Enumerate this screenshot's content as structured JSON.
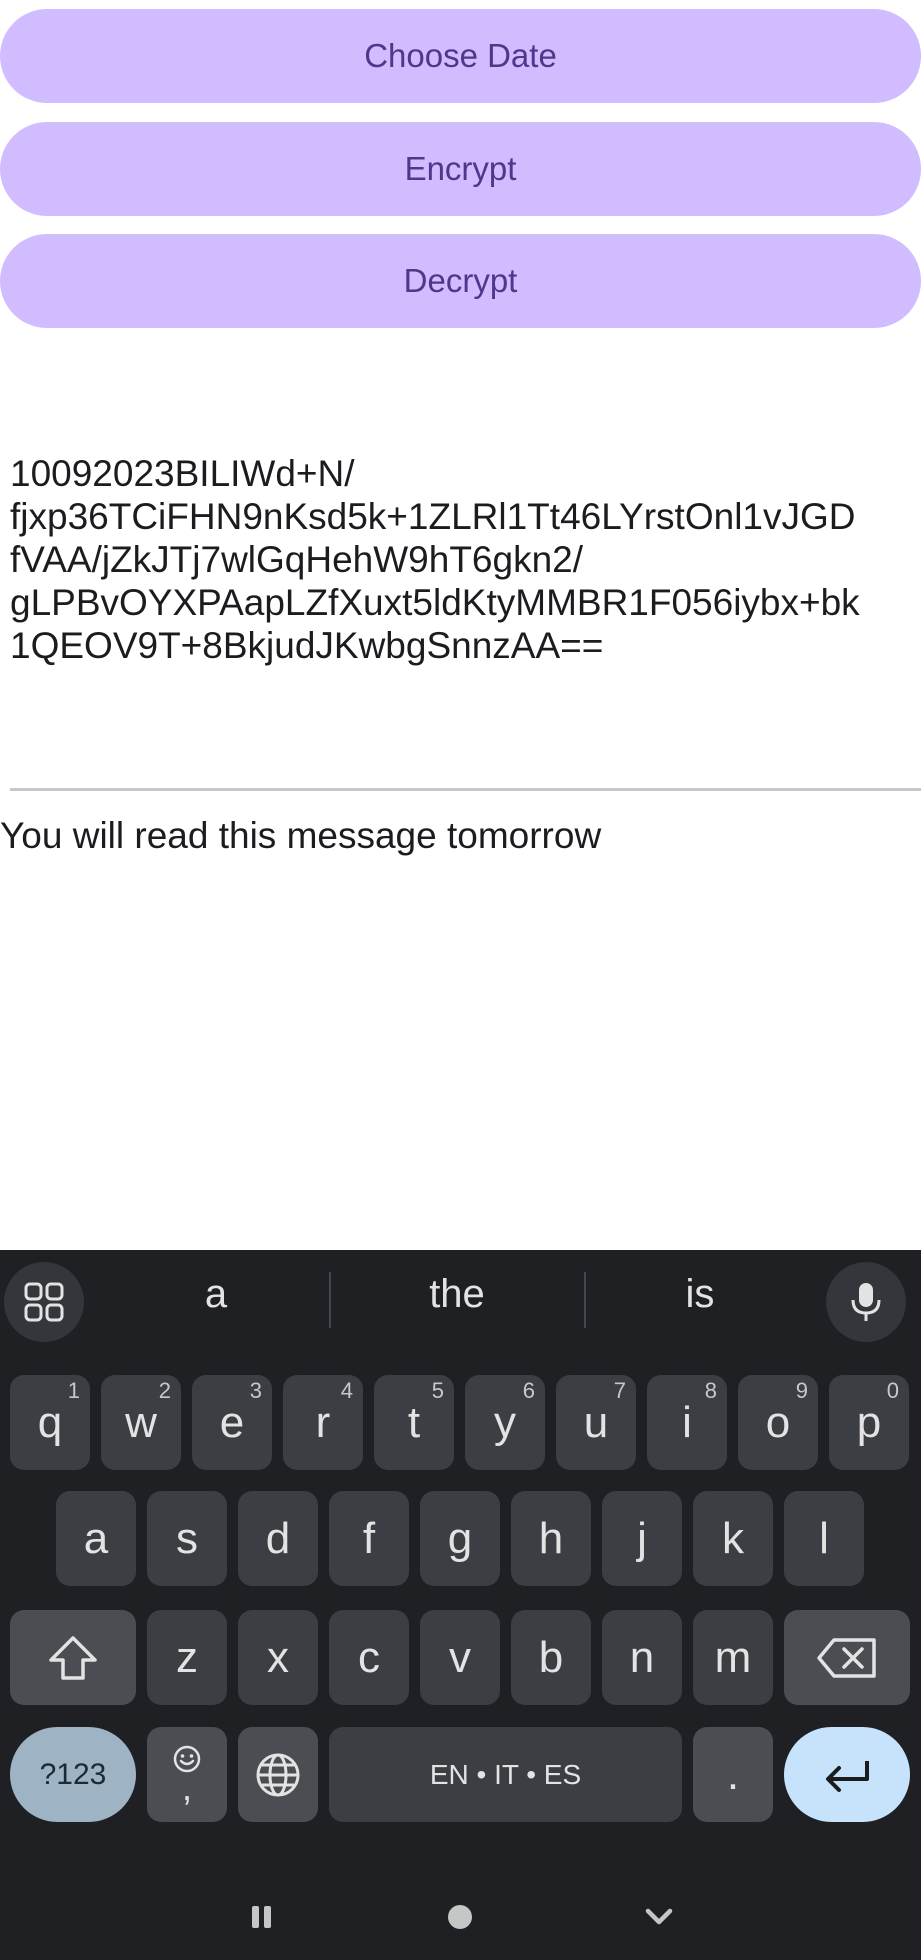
{
  "buttons": {
    "choose_date": "Choose Date",
    "encrypt": "Encrypt",
    "decrypt": "Decrypt"
  },
  "ciphertext_lines": [
    "10092023BILIWd+N/",
    "fjxp36TCiFHN9nKsd5k+1ZLRl1Tt46LYrstOnl1vJGD",
    "fVAA/jZkJTj7wlGqHehW9hT6gkn2/",
    "gLPBvOYXPAapLZfXuxt5ldKtyMMBR1F056iybx+bk",
    "1QEOV9T+8BkjudJKwbgSnnzAA=="
  ],
  "message": "You will read this message tomorrow",
  "keyboard": {
    "suggestions": [
      "a",
      "the",
      "is"
    ],
    "row1": [
      {
        "key": "q",
        "hint": "1"
      },
      {
        "key": "w",
        "hint": "2"
      },
      {
        "key": "e",
        "hint": "3"
      },
      {
        "key": "r",
        "hint": "4"
      },
      {
        "key": "t",
        "hint": "5"
      },
      {
        "key": "y",
        "hint": "6"
      },
      {
        "key": "u",
        "hint": "7"
      },
      {
        "key": "i",
        "hint": "8"
      },
      {
        "key": "o",
        "hint": "9"
      },
      {
        "key": "p",
        "hint": "0"
      }
    ],
    "row2": [
      "a",
      "s",
      "d",
      "f",
      "g",
      "h",
      "j",
      "k",
      "l"
    ],
    "row3": [
      "z",
      "x",
      "c",
      "v",
      "b",
      "n",
      "m"
    ],
    "mode_key": "?123",
    "emoji_key_comma": ",",
    "space_label": "EN • IT • ES",
    "period_key": ".",
    "icons": {
      "apps": "grid-icon",
      "mic": "microphone-icon",
      "shift": "shift-icon",
      "backspace": "backspace-icon",
      "emoji": "emoji-icon",
      "globe": "globe-icon",
      "enter": "enter-icon",
      "nav_recents": "recents-icon",
      "nav_home": "home-icon",
      "nav_back": "hide-keyboard-icon"
    }
  },
  "colors": {
    "button_bg": "#d0bcff",
    "button_text": "#4f378b",
    "keyboard_bg": "#1e2023",
    "key_bg": "#3b3e42",
    "enter_bg": "#c6e3fb",
    "mode_bg": "#9eb3c3"
  }
}
